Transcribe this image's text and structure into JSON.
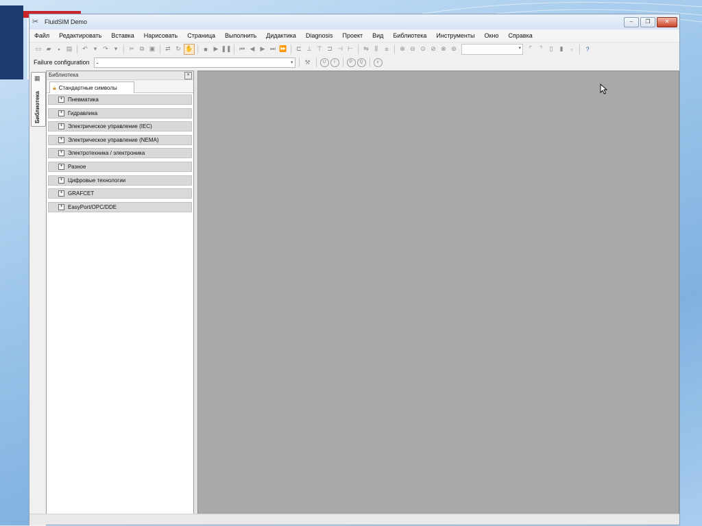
{
  "window": {
    "title": "FluidSIM Demo"
  },
  "menu": [
    "Файл",
    "Редактировать",
    "Вставка",
    "Нарисовать",
    "Страница",
    "Выполнить",
    "Дидактика",
    "Diagnosis",
    "Проект",
    "Вид",
    "Библиотека",
    "Инструменты",
    "Окно",
    "Справка"
  ],
  "toolbar2": {
    "failure_label": "Failure configuration",
    "failure_value": "-"
  },
  "vtab": {
    "label": "Библиотека"
  },
  "library": {
    "header": "Библиотека",
    "tab_label": "Стандартные символы",
    "items": [
      "Пневматика",
      "Гидравлика",
      "Электрическое управление (IEC)",
      "Электрическое управление (NEMA)",
      "Электротехника / электроника",
      "Разное",
      "Цифровые технологии",
      "GRAFCET",
      "EasyPort/OPC/DDE"
    ]
  },
  "colors": {
    "canvas": "#a9a9a9",
    "slide_navy": "#1f3b6e",
    "slide_red": "#c8262b"
  }
}
